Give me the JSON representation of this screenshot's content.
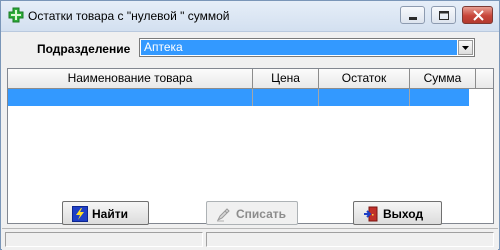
{
  "window": {
    "title": "Остатки товара с \"нулевой \" суммой",
    "app_icon": "green-plus-cross-icon",
    "controls": [
      "minimize-icon",
      "maximize-icon",
      "close-icon"
    ]
  },
  "department": {
    "label": "Подразделение",
    "selected": "Аптека"
  },
  "table": {
    "columns": [
      "Наименование товара",
      "Цена",
      "Остаток",
      "Сумма"
    ],
    "rows": [
      {
        "selected": true,
        "cells": [
          "",
          "",
          "",
          ""
        ]
      }
    ]
  },
  "buttons": {
    "find": {
      "label": "Найти",
      "icon": "lightning-icon",
      "enabled": true
    },
    "write_off": {
      "label": "Списать",
      "icon": "write-off-icon",
      "enabled": false
    },
    "exit": {
      "label": "Выход",
      "icon": "exit-door-icon",
      "enabled": true
    }
  },
  "statusbar": {
    "panels": [
      "",
      ""
    ]
  },
  "colors": {
    "selection": "#3399ff",
    "find_icon": "#1e3fc6",
    "exit_icon": "#c0302a"
  }
}
